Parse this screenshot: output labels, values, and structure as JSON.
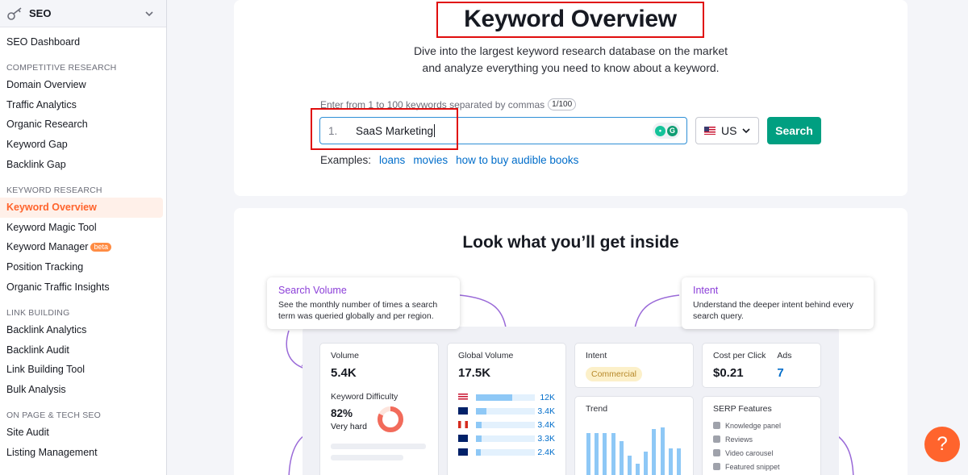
{
  "sidebar": {
    "header": "SEO",
    "top_item": "SEO Dashboard",
    "sections": [
      {
        "title": "COMPETITIVE RESEARCH",
        "items": [
          "Domain Overview",
          "Traffic Analytics",
          "Organic Research",
          "Keyword Gap",
          "Backlink Gap"
        ]
      },
      {
        "title": "KEYWORD RESEARCH",
        "items": [
          "Keyword Overview",
          "Keyword Magic Tool",
          "Keyword Manager",
          "Position Tracking",
          "Organic Traffic Insights"
        ]
      },
      {
        "title": "LINK BUILDING",
        "items": [
          "Backlink Analytics",
          "Backlink Audit",
          "Link Building Tool",
          "Bulk Analysis"
        ]
      },
      {
        "title": "ON PAGE & TECH SEO",
        "items": [
          "Site Audit",
          "Listing Management"
        ]
      }
    ],
    "active_item": "Keyword Overview",
    "beta_label": "beta"
  },
  "header": {
    "title": "Keyword Overview",
    "subtitle_line1": "Dive into the largest keyword research database on the market",
    "subtitle_line2": "and analyze everything you need to know about a keyword."
  },
  "search": {
    "hint": "Enter from 1 to 100 keywords separated by commas",
    "counter": "1/100",
    "line_number": "1.",
    "value": "SaaS Marketing",
    "country": "US",
    "button": "Search",
    "examples_label": "Examples:",
    "examples": [
      "loans",
      "movies",
      "how to buy audible books"
    ]
  },
  "preview": {
    "title": "Look what you’ll get inside",
    "tip_volume": {
      "title": "Search Volume",
      "desc": "See the monthly number of times a search term was queried globally and per region."
    },
    "tip_intent": {
      "title": "Intent",
      "desc": "Understand the deeper intent behind every search query."
    },
    "volume": {
      "label": "Volume",
      "value": "5.4K"
    },
    "difficulty": {
      "label": "Keyword Difficulty",
      "value": "82%",
      "level": "Very hard",
      "percent": 82
    },
    "global_volume": {
      "label": "Global Volume",
      "value": "17.5K",
      "rows": [
        {
          "country": "us",
          "value": "12K",
          "fill": 0.62
        },
        {
          "country": "uk",
          "value": "3.4K",
          "fill": 0.18
        },
        {
          "country": "ca",
          "value": "3.4K",
          "fill": 0.1
        },
        {
          "country": "au",
          "value": "3.3K",
          "fill": 0.1
        },
        {
          "country": "nz",
          "value": "2.4K",
          "fill": 0.08
        }
      ]
    },
    "intent": {
      "label": "Intent",
      "badge": "Commercial"
    },
    "cpc": {
      "label": "Cost per Click",
      "value": "$0.21"
    },
    "ads": {
      "label": "Ads",
      "value": "7"
    },
    "trend": {
      "label": "Trend",
      "values": [
        0.85,
        0.85,
        0.85,
        0.85,
        0.72,
        0.48,
        0.35,
        0.55,
        0.92,
        0.95,
        0.6,
        0.6
      ]
    },
    "serp": {
      "label": "SERP Features",
      "items": [
        "Knowledge panel",
        "Reviews",
        "Video carousel",
        "Featured snippet"
      ]
    }
  },
  "help_button": "?",
  "colors": {
    "accent": "#ff642d",
    "search_button": "#009f81",
    "link": "#006dca",
    "highlight_box": "#e00d0d"
  }
}
